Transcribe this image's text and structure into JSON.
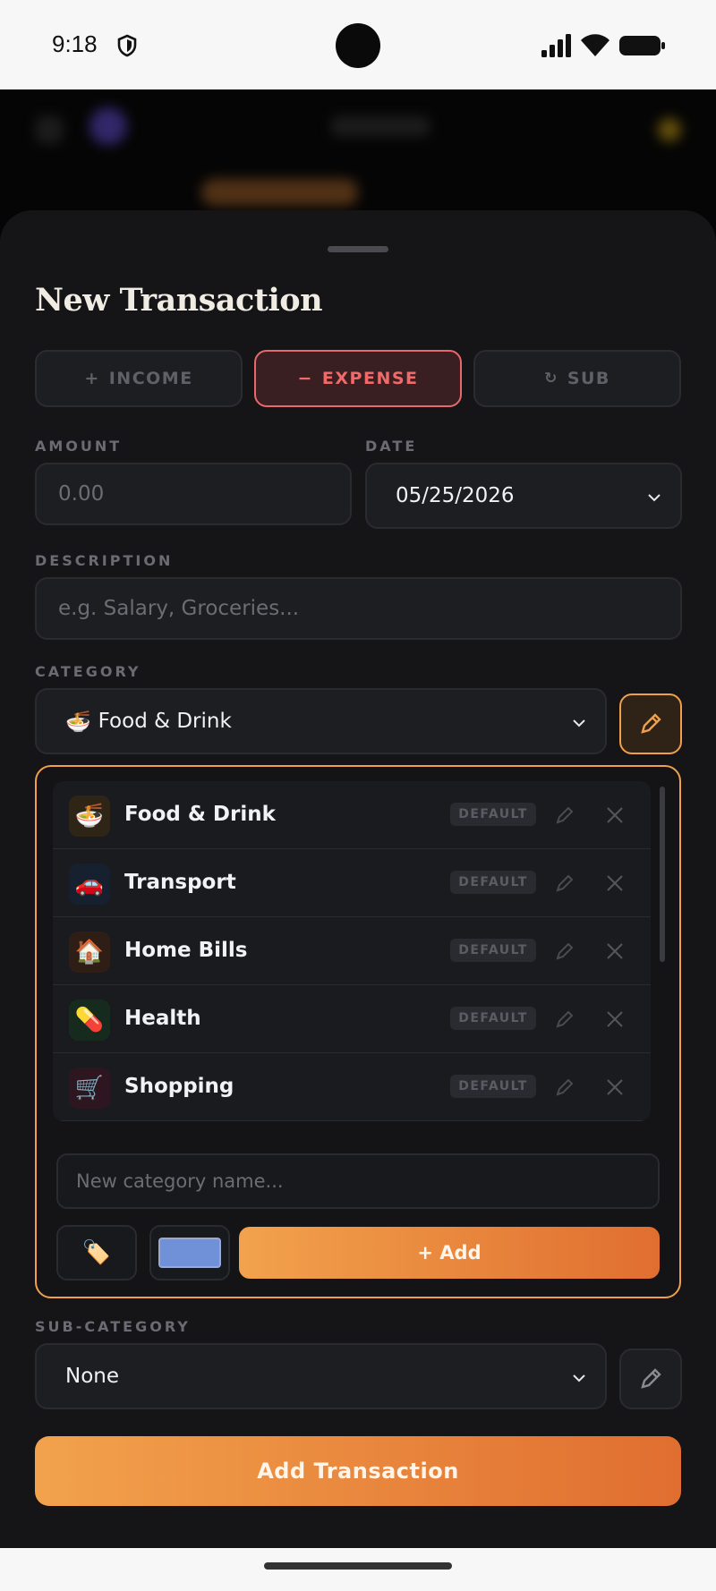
{
  "status_bar": {
    "time": "9:18"
  },
  "sheet": {
    "title": "New Transaction",
    "types": [
      {
        "icon": "+",
        "label": "INCOME",
        "active": false
      },
      {
        "icon": "−",
        "label": "EXPENSE",
        "active": true
      },
      {
        "icon": "↻",
        "label": "SUB",
        "active": false
      }
    ],
    "amount": {
      "label": "AMOUNT",
      "placeholder": "0.00"
    },
    "date": {
      "label": "DATE",
      "value": "05/25/2026"
    },
    "description": {
      "label": "DESCRIPTION",
      "placeholder": "e.g. Salary, Groceries..."
    },
    "category": {
      "label": "CATEGORY",
      "selected_icon": "🍜",
      "selected": "Food & Drink",
      "items": [
        {
          "icon": "🍜",
          "name": "Food & Drink",
          "badge": "DEFAULT"
        },
        {
          "icon": "🚗",
          "name": "Transport",
          "badge": "DEFAULT"
        },
        {
          "icon": "🏠",
          "name": "Home Bills",
          "badge": "DEFAULT"
        },
        {
          "icon": "💊",
          "name": "Health",
          "badge": "DEFAULT"
        },
        {
          "icon": "🛒",
          "name": "Shopping",
          "badge": "DEFAULT"
        }
      ],
      "new_placeholder": "New category name...",
      "tag_icon": "🏷️",
      "swatch_color": "#7090d8",
      "add_label": "+ Add"
    },
    "subcategory": {
      "label": "SUB-CATEGORY",
      "value": "None"
    },
    "submit_label": "Add Transaction"
  },
  "colors": {
    "accent": "#f0a04a",
    "expense": "#f06a6a",
    "sheet_bg": "#151518"
  }
}
